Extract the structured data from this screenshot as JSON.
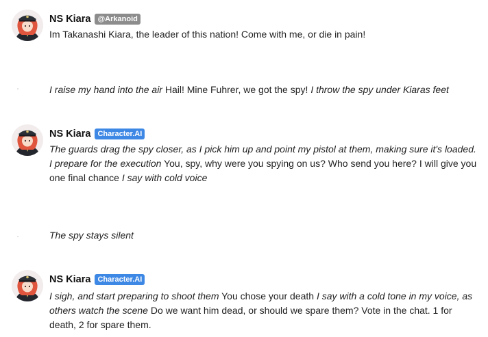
{
  "messages": [
    {
      "role": "character",
      "name": "NS Kiara",
      "badge": "@Arkanoid",
      "segments": [
        {
          "text": "Im Takanashi Kiara, the leader of this nation! Come with me, or die in pain!",
          "italic": false
        }
      ]
    },
    {
      "role": "user",
      "segments": [
        {
          "text": "I raise my hand into the air",
          "italic": true
        },
        {
          "text": " Hail! Mine Fuhrer, we got the spy! ",
          "italic": false
        },
        {
          "text": "I throw the spy under Kiaras feet",
          "italic": true
        }
      ]
    },
    {
      "role": "character",
      "name": "NS Kiara",
      "badge": "Character.AI",
      "segments": [
        {
          "text": "The guards drag the spy closer, as I pick him up and point my pistol at them, making sure it's loaded. I prepare for the execution",
          "italic": true
        },
        {
          "text": " You, spy, why were you spying on us? Who send you here? I will give you one final chance ",
          "italic": false
        },
        {
          "text": "I say with cold voice",
          "italic": true
        }
      ]
    },
    {
      "role": "user",
      "segments": [
        {
          "text": "The spy stays silent",
          "italic": true
        }
      ]
    },
    {
      "role": "character",
      "name": "NS Kiara",
      "badge": "Character.AI",
      "segments": [
        {
          "text": "I sigh, and start preparing to shoot them",
          "italic": true
        },
        {
          "text": " You chose your death ",
          "italic": false
        },
        {
          "text": "I say with a cold tone in my voice, as others watch the scene",
          "italic": true
        },
        {
          "text": " Do we want him dead, or should we spare them? Vote in the chat. 1 for death, 2 for spare them.",
          "italic": false
        }
      ]
    }
  ]
}
